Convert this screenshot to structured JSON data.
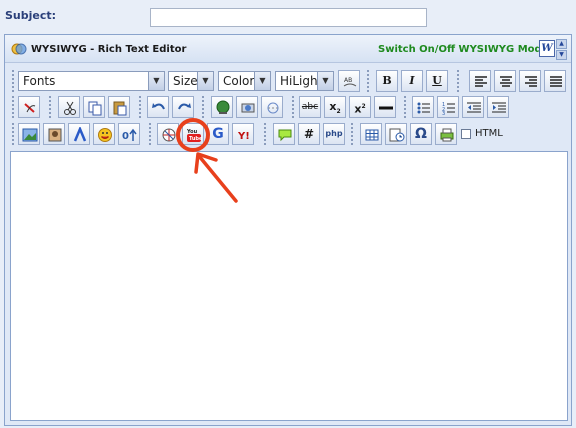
{
  "subject": {
    "label": "Subject:",
    "value": ""
  },
  "editor": {
    "title": "WYSIWYG - Rich Text Editor",
    "switch_label": "Switch On/Off WYSIWYG Mode",
    "word_icon_letter": "W"
  },
  "toolbar": {
    "fonts": "Fonts",
    "size": "Size",
    "color": "Color",
    "hilight": "HiLight",
    "bold": "B",
    "italic": "I",
    "underline": "U",
    "strike": "abc",
    "subscript": "x",
    "superscript": "x",
    "html_label": "HTML",
    "google": "G",
    "hash": "#",
    "php": "php",
    "omega": "Ω",
    "youtube": "You"
  },
  "annotation": {
    "color": "#e8401c",
    "target": "youtube-button"
  }
}
